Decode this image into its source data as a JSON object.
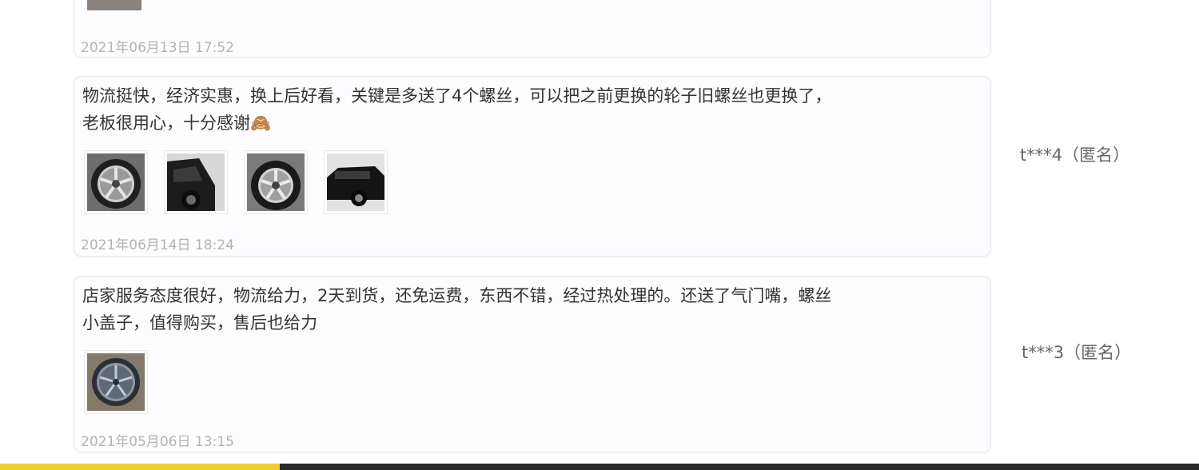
{
  "reviews": [
    {
      "text": "",
      "date": "2021年06月13日 17:52",
      "reviewer": ""
    },
    {
      "text": "物流挺快，经济实惠，换上后好看，关键是多送了4个螺丝，可以把之前更换的轮子旧螺丝也更换了，\n老板很用心，十分感谢🙈",
      "date": "2021年06月14日 18:24",
      "reviewer": "t***4（匿名）",
      "photos": [
        "wheel-photo",
        "car-side-photo",
        "wheel-photo",
        "car-rear-photo"
      ]
    },
    {
      "text": "店家服务态度很好，物流给力，2天到货，还免运费，东西不错，经过热处理的。还送了气门嘴，螺丝\n小盖子，值得购买，售后也给力",
      "date": "2021年05月06日 13:15",
      "reviewer": "t***3（匿名）",
      "photos": [
        "wheel-closeup-photo"
      ]
    }
  ],
  "colors": {
    "card_border": "#ebe6ee",
    "date_text": "#b3b3b3",
    "bottom_accent": "#f0cf2a",
    "bottom_bar": "#2a2a2a"
  }
}
